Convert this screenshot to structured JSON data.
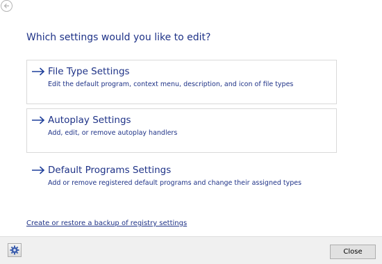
{
  "heading": "Which settings would you like to edit?",
  "options": [
    {
      "title": "File Type Settings",
      "description": "Edit the default program, context menu, description, and icon of file types"
    },
    {
      "title": "Autoplay Settings",
      "description": "Add, edit, or remove autoplay handlers"
    },
    {
      "title": "Default Programs Settings",
      "description": "Add or remove registered default programs and change their assigned types"
    }
  ],
  "backup_link": "Create or restore a backup of registry settings",
  "footer": {
    "close_label": "Close",
    "settings_icon": "gear-icon"
  },
  "colors": {
    "link_text": "#1e3287",
    "arrow": "#1f3f9b",
    "option_border": "#d9d9d9",
    "footer_bg": "#f0f0f0"
  }
}
